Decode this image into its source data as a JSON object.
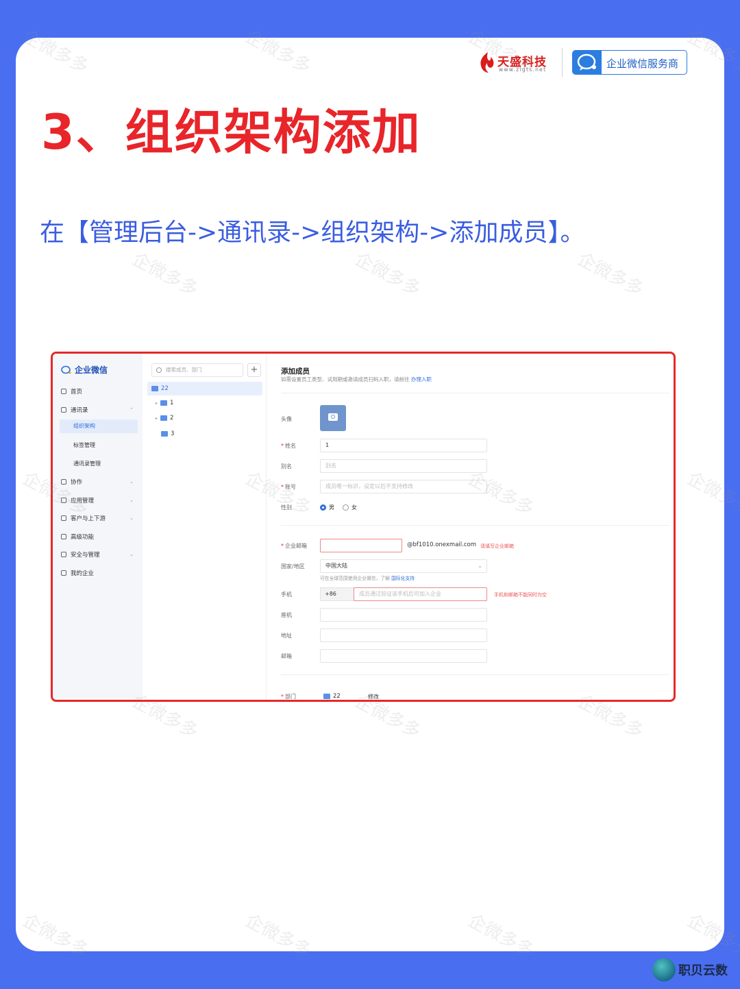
{
  "brand": {
    "company_name": "天盛科技",
    "company_url": "www.zigts.net",
    "badge_label": "企业微信服务商",
    "footer_brand": "职贝云数"
  },
  "watermark": "企微多多",
  "title": "3、组织架构添加",
  "subtitle": "在【管理后台->通讯录->组织架构->添加成员】。",
  "screenshot": {
    "app_name": "企业微信",
    "nav": [
      {
        "label": "首页"
      },
      {
        "label": "通讯录"
      },
      {
        "label": "协作"
      },
      {
        "label": "应用管理"
      },
      {
        "label": "客户与上下游"
      },
      {
        "label": "高级功能"
      },
      {
        "label": "安全与管理"
      },
      {
        "label": "我的企业"
      }
    ],
    "contacts_sub": [
      "组织架构",
      "标签管理",
      "通讯录管理"
    ],
    "search_placeholder": "搜索成员、部门",
    "add_symbol": "+",
    "tree": [
      "22",
      "1",
      "2",
      "3"
    ],
    "form": {
      "title": "添加成员",
      "desc": "如需设置员工类型、试用期或邀请成员扫码入职，请前往",
      "desc_link": "办理入职",
      "avatar_label": "头像",
      "name_label": "姓名",
      "name_value": "1",
      "alias_label": "别名",
      "alias_placeholder": "别名",
      "account_label": "账号",
      "account_placeholder": "成员唯一标识，设定以后不支持修改",
      "gender_label": "性别",
      "gender_male": "男",
      "gender_female": "女",
      "email_label": "企业邮箱",
      "email_suffix": "@bf1010.onexmail.com",
      "email_error": "请填写企业邮箱",
      "region_label": "国家/地区",
      "region_value": "中国大陆",
      "region_hint": "可在全球范围使用企业微信，了解",
      "region_hint_link": "国际化支持",
      "phone_label": "手机",
      "phone_prefix": "+86",
      "phone_placeholder": "成员通过验证该手机后可加入企业",
      "phone_error": "手机和邮箱不能同时为空",
      "tel_label": "座机",
      "address_label": "地址",
      "mail_label": "邮箱",
      "dept_label": "部门",
      "dept_value": "22",
      "dept_edit": "修改"
    }
  }
}
